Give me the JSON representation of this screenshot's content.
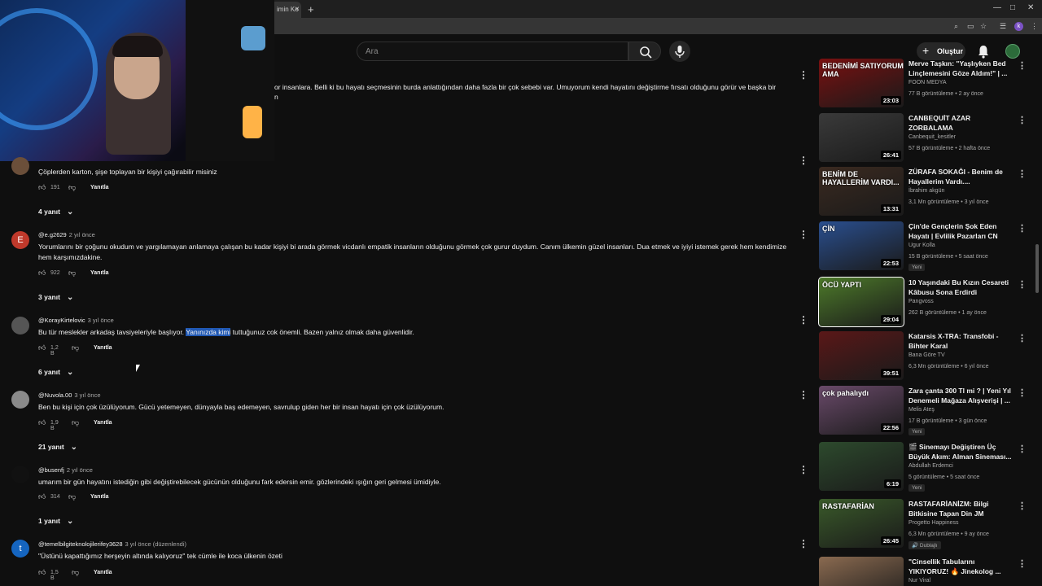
{
  "browser": {
    "tab_title": "imin Ko",
    "tab_close": "×",
    "new_tab": "+"
  },
  "header": {
    "search_placeholder": "Ara",
    "create_label": "Oluştur",
    "profile_letter": "k"
  },
  "top_comment": {
    "text_line1": "or insanlara. Belli ki bu hayatı seçmesinin burda anlattığından daha fazla bir çok sebebi var. Umuyorum kendi hayatını değiştirme fırsatı olduğunu görür ve başka bir",
    "text_line2": "n"
  },
  "comments": [
    {
      "avatar": "",
      "avatar_color": "#6b4f3a",
      "author": "",
      "time": "",
      "text": "Çöplerden karton, şişe toplayan bir kişiyi çağırabilir misiniz",
      "likes": "191",
      "reply_label": "Yanıtla",
      "replies": "4 yanıt"
    },
    {
      "avatar": "E",
      "avatar_color": "#c0392b",
      "author": "@e.g2629",
      "time": "2 yıl önce",
      "text": "Yorumlarını bir çoğunu okudum ve yargılamayan anlamaya çalışan bu kadar kişiyi bi arada görmek vicdanlı empatik insanların olduğunu görmek çok gurur duydum. Canım ülkemin güzel insanları. Dua etmek ve iyiyi istemek gerek hem kendimize hem karşımızdakine.",
      "likes": "922",
      "reply_label": "Yanıtla",
      "replies": "3 yanıt"
    },
    {
      "avatar": "",
      "avatar_color": "#555555",
      "author": "@KorayKirtelovic",
      "time": "3 yıl önce",
      "text_before": "Bu tür meslekler arkadaş tavsiyeleriyle başlıyor. ",
      "text_highlight": "Yanınızda kimi",
      "text_after": " tuttuğunuz cok önemli. Bazen yalnız olmak daha güvenlidir.",
      "likes": "1,2 B",
      "reply_label": "Yanıtla",
      "replies": "6 yanıt"
    },
    {
      "avatar": "",
      "avatar_color": "#8a8a8a",
      "author": "@Nuvola.00",
      "time": "3 yıl önce",
      "text": "Ben bu kişi için çok üzülüyorum. Gücü yetemeyen, dünyayla baş edemeyen, savrulup giden her bir insan hayatı için çok üzülüyorum.",
      "likes": "1,9 B",
      "reply_label": "Yanıtla",
      "replies": "21 yanıt"
    },
    {
      "avatar": "",
      "avatar_color": "#111111",
      "author": "@busenfj",
      "time": "2 yıl önce",
      "text": "umarım bir gün hayatını istediğin gibi değiştirebilecek gücünün olduğunu fark edersin emir. gözlerindeki ışığın geri gelmesi ümidiyle.",
      "likes": "314",
      "reply_label": "Yanıtla",
      "replies": "1 yanıt"
    },
    {
      "avatar": "t",
      "avatar_color": "#1565c0",
      "author": "@temelbilgiteknolojilerifey3628",
      "time": "3 yıl önce (düzenlendi)",
      "text": "\"Üstünü kapattığımız herşeyin altında kalıyoruz\" tek cümle ile koca ülkenin özeti",
      "likes": "1,5 B",
      "reply_label": "Yanıtla",
      "replies": ""
    }
  ],
  "recommendations": [
    {
      "thumb_text": "BEDENİMİ SATIYORUM AMA",
      "thumb_color": "#7a1010",
      "duration": "23:03",
      "title": "Merve Taşkın: \"Yaşlıyken Bed Linçlemesini Göze Aldım!\" | ...",
      "channel": "FOON MEDYA",
      "meta": "77 B görüntüleme • 2 ay önce",
      "badge": ""
    },
    {
      "thumb_text": "",
      "thumb_color": "#3a3a3a",
      "duration": "26:41",
      "title": "CANBEQUİT AZAR ZORBALAMA",
      "channel": "Canbequit_kesitler",
      "meta": "57 B görüntüleme • 2 hafta önce",
      "badge": ""
    },
    {
      "thumb_text": "BENİM DE HAYALLERİM VARDI...",
      "thumb_color": "#3b2a20",
      "duration": "13:31",
      "title": "ZÜRAFA SOKAĞI - Benim de Hayallerim Vardı....",
      "channel": "İbrahim akgün",
      "meta": "3,1 Mn görüntüleme • 3 yıl önce",
      "badge": ""
    },
    {
      "thumb_text": "ÇİN",
      "thumb_color": "#2a4f8f",
      "duration": "22:53",
      "title": "Çin'de Gençlerin Şok Eden Hayatı | Evlilik Pazarları CN",
      "channel": "Ugur Kolla",
      "meta": "15 B görüntüleme • 5 saat önce",
      "badge": "Yeni"
    },
    {
      "thumb_text": "ÖCÜ YAPTI",
      "thumb_color": "#4d7a2a",
      "duration": "29:04",
      "title": "10 Yaşındaki Bu Kızın Cesareti Kâbusu Sona Erdirdi",
      "channel": "Pangvoss",
      "meta": "262 B görüntüleme • 1 ay önce",
      "badge": ""
    },
    {
      "thumb_text": "",
      "thumb_color": "#5a1818",
      "duration": "39:51",
      "title": "Katarsis X-TRA: Transfobi - Bihter Karal",
      "channel": "Bana Göre TV",
      "meta": "6,3 Mn görüntüleme • 6 yıl önce",
      "badge": ""
    },
    {
      "thumb_text": "çok pahalıydı",
      "thumb_color": "#6a4a6a",
      "duration": "22:56",
      "title": "Zara çanta 300 Tl mi ? | Yeni Yıl Denemeli Mağaza Alışverişi | ...",
      "channel": "Melis Ateş",
      "meta": "17 B görüntüleme • 3 gün önce",
      "badge": "Yeni"
    },
    {
      "thumb_text": "",
      "thumb_color": "#2d4a2d",
      "duration": "6:19",
      "title": "🎬 Sinemayı Değiştiren Üç Büyük Akım: Alman Sineması...",
      "channel": "Abdullah Erdemci",
      "meta": "5 görüntüleme • 5 saat önce",
      "badge": "Yeni"
    },
    {
      "thumb_text": "RASTAFARİAN",
      "thumb_color": "#3a5a2a",
      "duration": "26:45",
      "title": "RASTAFARİANİZM: Bilgi Bitkisine Tapan Din JM",
      "channel": "Progetto Happiness",
      "meta": "6,3 Mn görüntüleme • 9 ay önce",
      "badge": "🔊 Dublajlı"
    },
    {
      "thumb_text": "",
      "thumb_color": "#8a6a50",
      "duration": "",
      "title": "\"Cinsellik Tabularını YIKIYORUZ! 🔥 Jinekolog ...",
      "channel": "Nur Viral",
      "meta": "",
      "badge": ""
    }
  ]
}
